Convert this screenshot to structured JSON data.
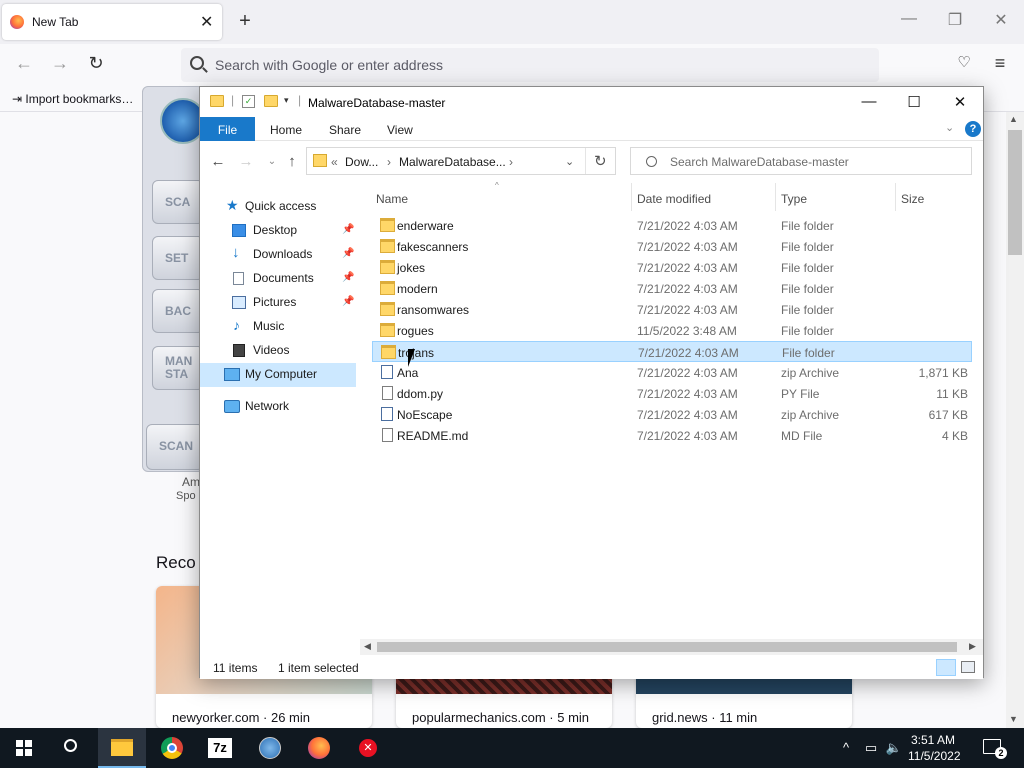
{
  "browser": {
    "tab_title": "New Tab",
    "tab_close": "✕",
    "new_tab": "+",
    "url_placeholder": "Search with Google or enter address",
    "bookmark": "Import bookmarks…",
    "recent_heading": "Reco",
    "cards": [
      {
        "caption": "newyorker.com · 26 min"
      },
      {
        "caption": "popularmechanics.com · 5 min"
      },
      {
        "caption": "grid.news · 11 min"
      }
    ]
  },
  "background_app": {
    "buttons": [
      "SCA",
      "SET",
      "BAC",
      "MAN STA",
      "SCAN"
    ],
    "caption1": "Am",
    "caption2": "Spo"
  },
  "explorer": {
    "title": "MalwareDatabase-master",
    "ribbon_tabs": {
      "file": "File",
      "home": "Home",
      "share": "Share",
      "view": "View"
    },
    "help": "?",
    "address": {
      "chevrons": "«",
      "crumb1": "Dow...",
      "sep": "›",
      "crumb2": "MalwareDatabase...",
      "sep2": "›"
    },
    "search_placeholder": "Search MalwareDatabase-master",
    "nav": {
      "quick_access": "Quick access",
      "desktop": "Desktop",
      "downloads": "Downloads",
      "documents": "Documents",
      "pictures": "Pictures",
      "music": "Music",
      "videos": "Videos",
      "my_computer": "My Computer",
      "network": "Network"
    },
    "columns": {
      "name": "Name",
      "date": "Date modified",
      "type": "Type",
      "size": "Size"
    },
    "files": [
      {
        "name": "enderware",
        "date": "7/21/2022 4:03 AM",
        "type": "File folder",
        "size": ""
      },
      {
        "name": "fakescanners",
        "date": "7/21/2022 4:03 AM",
        "type": "File folder",
        "size": ""
      },
      {
        "name": "jokes",
        "date": "7/21/2022 4:03 AM",
        "type": "File folder",
        "size": ""
      },
      {
        "name": "modern",
        "date": "7/21/2022 4:03 AM",
        "type": "File folder",
        "size": ""
      },
      {
        "name": "ransomwares",
        "date": "7/21/2022 4:03 AM",
        "type": "File folder",
        "size": ""
      },
      {
        "name": "rogues",
        "date": "11/5/2022 3:48 AM",
        "type": "File folder",
        "size": ""
      },
      {
        "name": "trojans",
        "date": "7/21/2022 4:03 AM",
        "type": "File folder",
        "size": ""
      },
      {
        "name": "Ana",
        "date": "7/21/2022 4:03 AM",
        "type": "zip Archive",
        "size": "1,871 KB"
      },
      {
        "name": "ddom.py",
        "date": "7/21/2022 4:03 AM",
        "type": "PY File",
        "size": "11 KB"
      },
      {
        "name": "NoEscape",
        "date": "7/21/2022 4:03 AM",
        "type": "zip Archive",
        "size": "617 KB"
      },
      {
        "name": "README.md",
        "date": "7/21/2022 4:03 AM",
        "type": "MD File",
        "size": "4 KB"
      }
    ],
    "status": {
      "items": "11 items",
      "selected": "1 item selected"
    }
  },
  "taskbar": {
    "time": "3:51 AM",
    "date": "11/5/2022",
    "notification_count": "2"
  }
}
